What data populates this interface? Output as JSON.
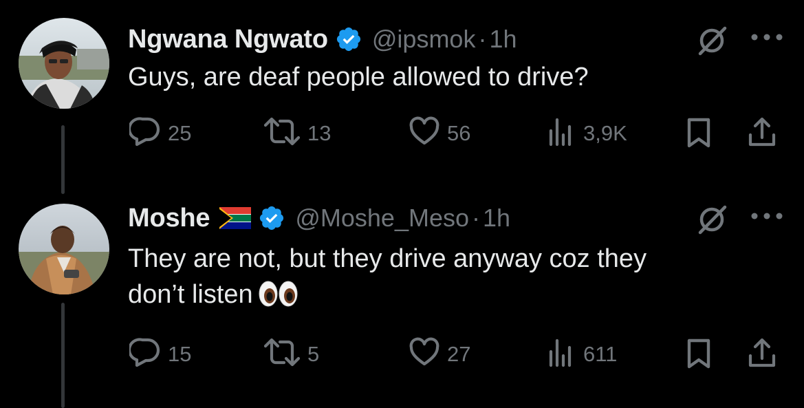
{
  "thread": [
    {
      "name": "Ngwana Ngwato",
      "handle": "@ipsmok",
      "separator": "·",
      "time": "1h",
      "text": "Guys, are deaf people allowed to drive?",
      "replies": "25",
      "reposts": "13",
      "likes": "56",
      "views": "3,9K"
    },
    {
      "name": "Moshe",
      "handle": "@Moshe_Meso",
      "separator": "·",
      "time": "1h",
      "text_line1": "They are not, but they drive anyway coz they",
      "text_line2": "don’t listen",
      "replies": "15",
      "reposts": "5",
      "likes": "27",
      "views": "611"
    }
  ],
  "icons": {
    "verified": "verified-badge-icon",
    "grok": "grok-icon",
    "more": "more-options-icon",
    "reply": "reply-icon",
    "repost": "repost-icon",
    "like": "like-icon",
    "views": "views-icon",
    "bookmark": "bookmark-icon",
    "share": "share-icon",
    "flag": "south-africa-flag-icon",
    "eyes": "eyes-emoji-icon"
  },
  "colors": {
    "background": "#000000",
    "text": "#e7e9ea",
    "secondary": "#71767b",
    "verified": "#1d9bf0",
    "thread_line": "#333639"
  }
}
